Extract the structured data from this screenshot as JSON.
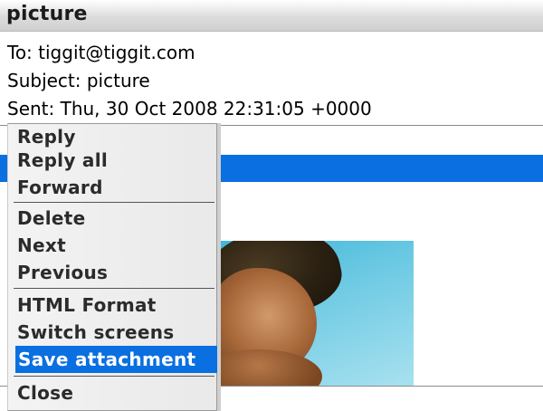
{
  "window": {
    "title": "picture"
  },
  "header": {
    "to": "To: tiggit@tiggit.com",
    "subject": "Subject: picture",
    "sent": "Sent: Thu, 30 Oct 2008 22:31:05 +0000"
  },
  "attachment": {
    "icon": "photo-icon",
    "selection_color": "#0a6fe0"
  },
  "menu": {
    "items": [
      "Reply",
      "Reply all",
      "Forward",
      "Delete",
      "Next",
      "Previous",
      "HTML Format",
      "Switch screens",
      "Save attachment",
      "Close"
    ],
    "selected": "Save attachment",
    "highlight_color": "#0a6fe0"
  }
}
